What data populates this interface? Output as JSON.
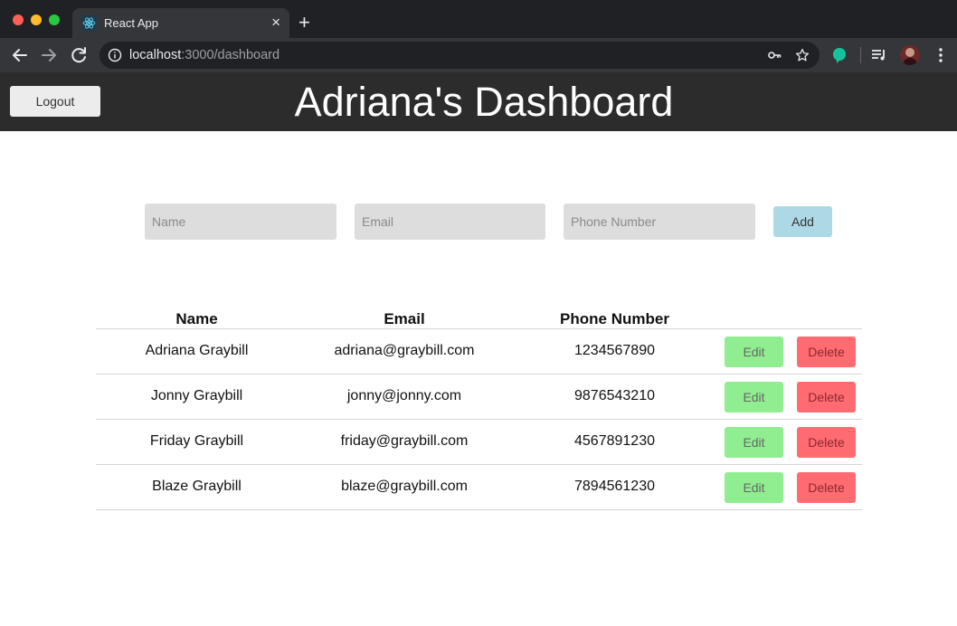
{
  "browser": {
    "tab_title": "React App",
    "tab_close": "×",
    "new_tab": "+",
    "url_host": "localhost",
    "url_path": ":3000/dashboard",
    "icons": {
      "favicon": "react-icon",
      "back": "back-arrow-icon",
      "forward": "forward-arrow-icon",
      "reload": "reload-icon",
      "info": "info-icon",
      "key": "key-icon",
      "star": "star-icon",
      "extension": "grammarly-icon",
      "media": "media-queue-icon",
      "menu": "kebab-menu-icon"
    }
  },
  "header": {
    "logout_label": "Logout",
    "title": "Adriana's Dashboard"
  },
  "form": {
    "name_placeholder": "Name",
    "email_placeholder": "Email",
    "phone_placeholder": "Phone Number",
    "add_label": "Add"
  },
  "table": {
    "headers": [
      "Name",
      "Email",
      "Phone Number"
    ],
    "edit_label": "Edit",
    "delete_label": "Delete",
    "rows": [
      {
        "name": "Adriana Graybill",
        "email": "adriana@graybill.com",
        "phone": "1234567890"
      },
      {
        "name": "Jonny Graybill",
        "email": "jonny@jonny.com",
        "phone": "9876543210"
      },
      {
        "name": "Friday Graybill",
        "email": "friday@graybill.com",
        "phone": "4567891230"
      },
      {
        "name": "Blaze Graybill",
        "email": "blaze@graybill.com",
        "phone": "7894561230"
      }
    ]
  },
  "colors": {
    "header_bg": "#2c2c2c",
    "input_bg": "#dddddd",
    "add_button": "#add8e6",
    "edit_button": "#90ee90",
    "delete_button": "#ff6b70"
  }
}
